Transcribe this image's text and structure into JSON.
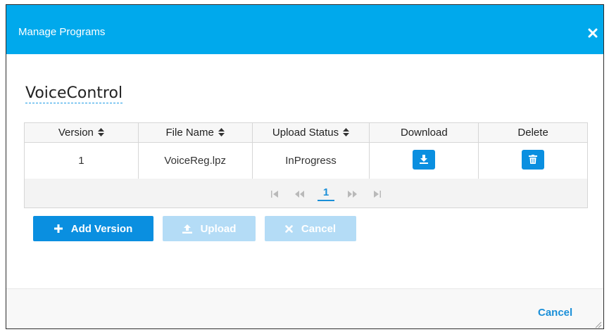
{
  "dialog": {
    "title": "Manage Programs",
    "close_icon": "close-icon"
  },
  "program": {
    "name": "VoiceControl"
  },
  "table": {
    "columns": [
      "Version",
      "File Name",
      "Upload Status",
      "Download",
      "Delete"
    ],
    "sortable_columns": [
      "Version",
      "File Name",
      "Upload Status"
    ],
    "rows": [
      {
        "version": "1",
        "file_name": "VoiceReg.lpz",
        "upload_status": "InProgress",
        "download_icon": "download-icon",
        "delete_icon": "trash-icon"
      }
    ]
  },
  "pager": {
    "current_page": "1",
    "icons": [
      "first-page-icon",
      "prev-page-icon",
      "next-page-icon",
      "last-page-icon"
    ]
  },
  "actions": {
    "add_version_label": "Add Version",
    "upload_label": "Upload",
    "cancel_label": "Cancel"
  },
  "footer": {
    "cancel_label": "Cancel"
  },
  "colors": {
    "header": "#00a9ec",
    "primary": "#0a8fe0",
    "disabled": "#b4dcf6",
    "link": "#1a8fd8"
  }
}
